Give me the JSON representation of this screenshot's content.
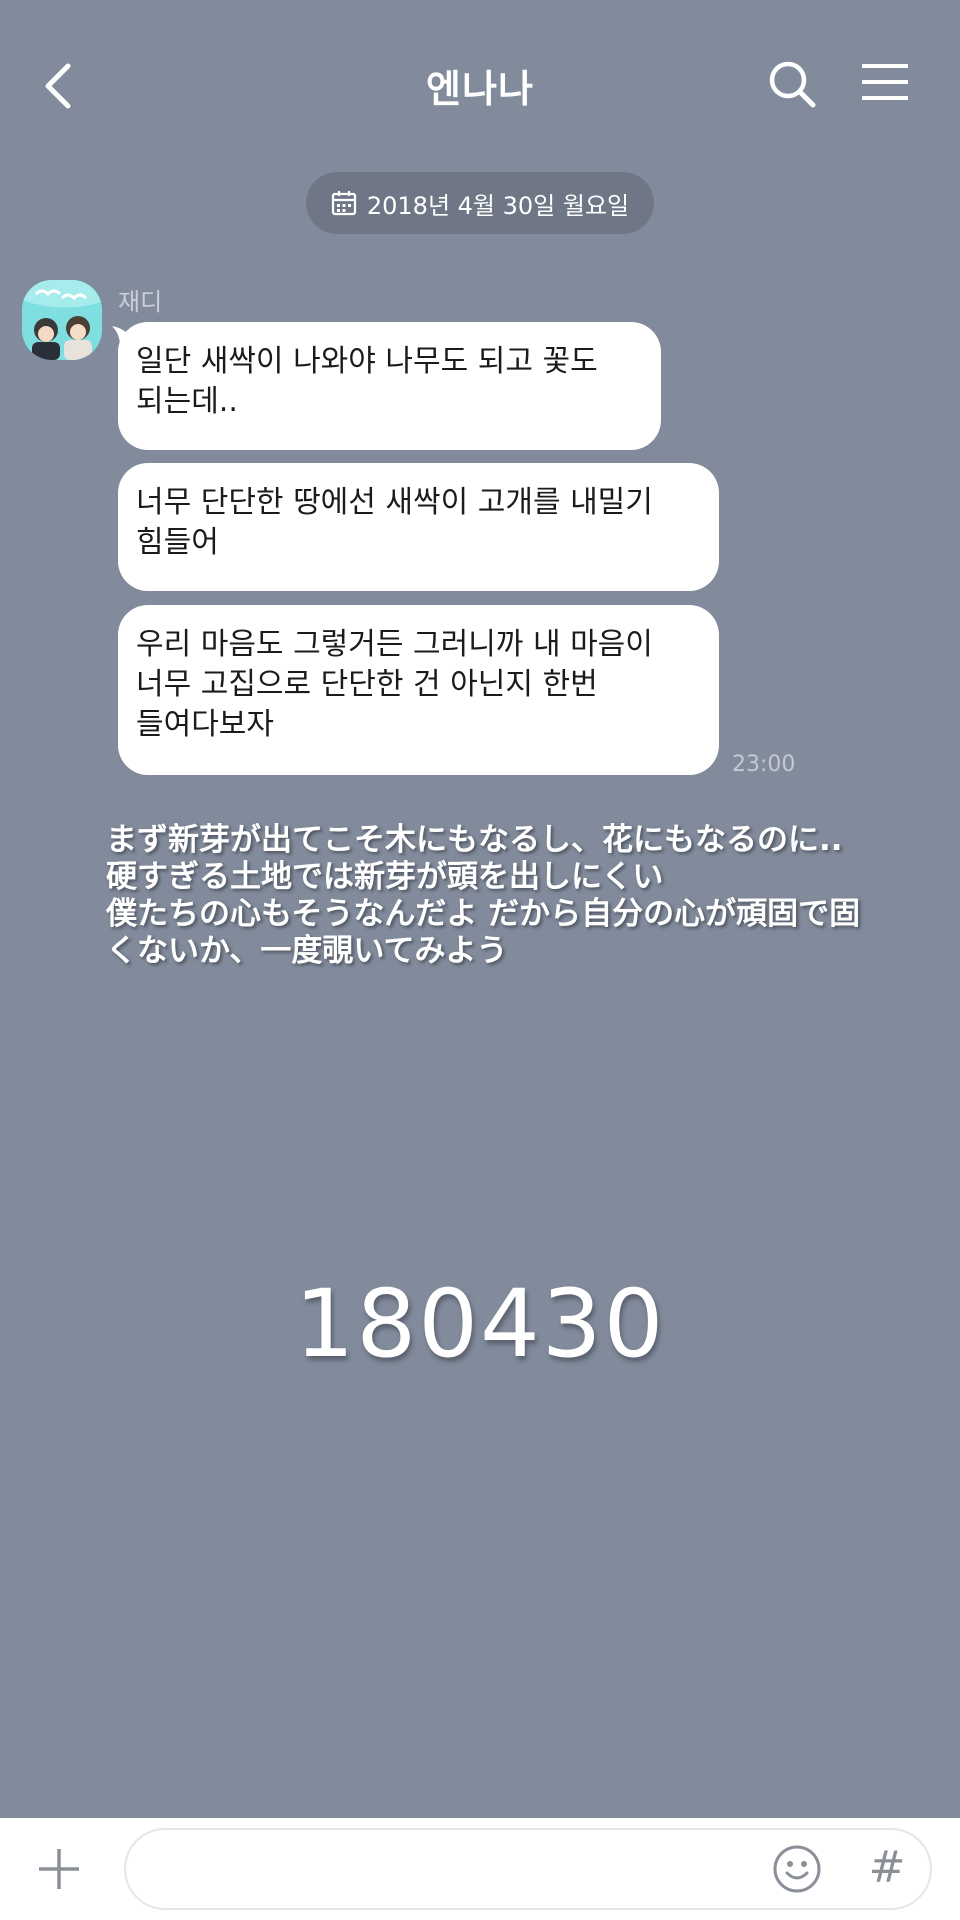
{
  "header": {
    "title": "엔나나",
    "back_icon": "chevron-left-icon",
    "search_icon": "search-icon",
    "menu_icon": "hamburger-menu-icon"
  },
  "date_divider": {
    "icon": "calendar-icon",
    "text": "2018년 4월 30일 월요일"
  },
  "message_group": {
    "sender": "재디",
    "avatar_icon": "profile-avatar",
    "time": "23:00",
    "messages": [
      {
        "text": "일단 새싹이 나와야 나무도 되고 꽃도\n되는데.."
      },
      {
        "text": "너무 단단한 땅에선 새싹이 고개를 내밀기\n힘들어"
      },
      {
        "text": "우리 마음도 그렇거든 그러니까 내 마음이\n너무 고집으로 단단한 건 아닌지 한번\n들여다보자"
      }
    ]
  },
  "overlay_caption": "まず新芽が出てこそ木にもなるし、花にもなるのに..\n硬すぎる土地では新芽が頭を出しにくい\n僕たちの心もそうなんだよ だから自分の心が頑固で固\nくないか、一度覗いてみよう",
  "overlay_date": "180430",
  "input_bar": {
    "plus_icon": "plus-icon",
    "placeholder": "",
    "emoji_icon": "emoji-icon",
    "hash_label": "#"
  },
  "colors": {
    "background": "#828b9b",
    "bubble": "#ffffff",
    "date_pill": "#6f7787"
  }
}
